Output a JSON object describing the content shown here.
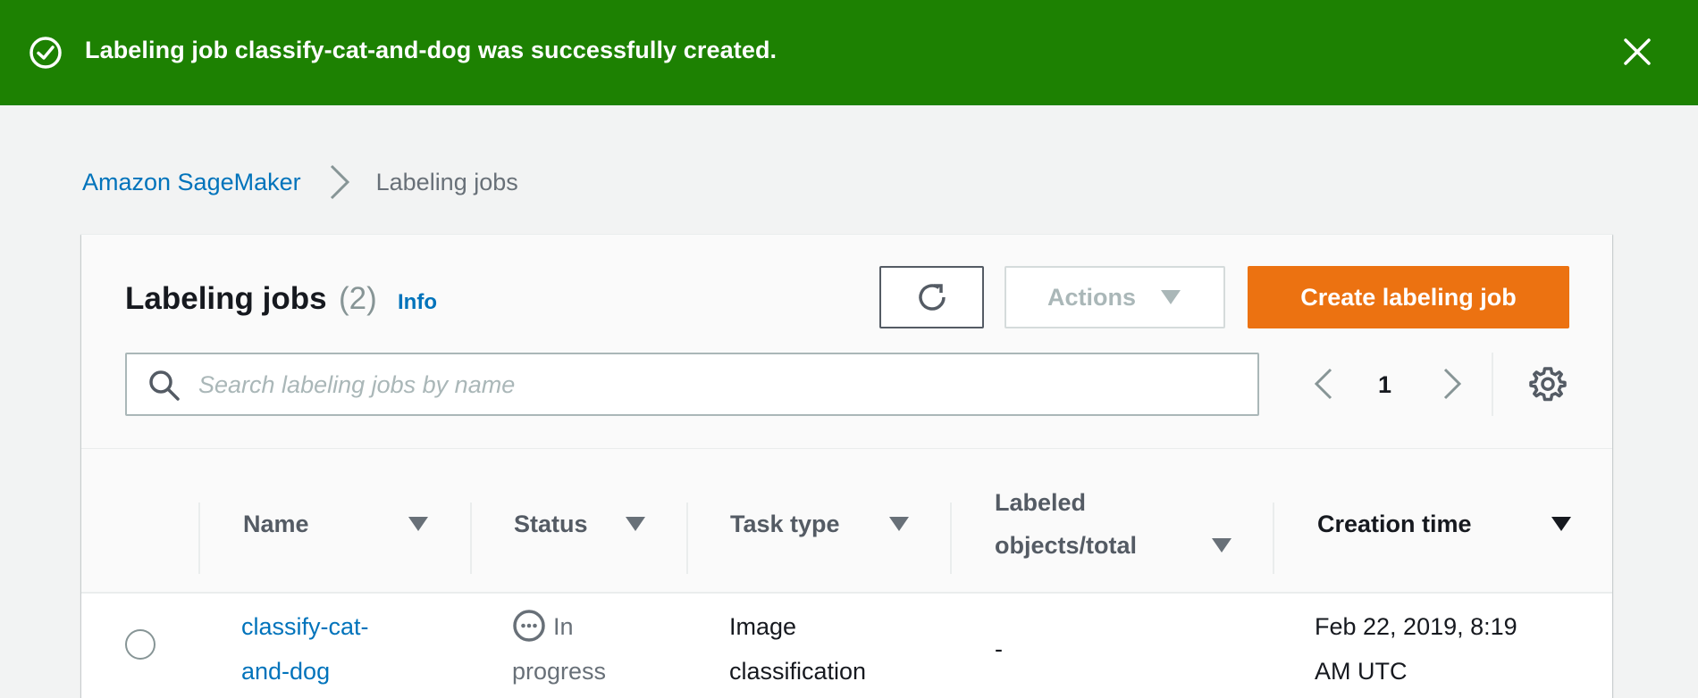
{
  "flash": {
    "message": "Labeling job classify-cat-and-dog was successfully created.",
    "type": "success",
    "color": "#1d8102"
  },
  "breadcrumb": {
    "root": "Amazon SageMaker",
    "current": "Labeling jobs"
  },
  "panel": {
    "title": "Labeling jobs",
    "count": "(2)",
    "info_label": "Info",
    "actions_label": "Actions",
    "create_label": "Create labeling job",
    "search_placeholder": "Search labeling jobs by name",
    "page_number": "1"
  },
  "table": {
    "columns": [
      {
        "label": "Name"
      },
      {
        "label": "Status"
      },
      {
        "label": "Task type"
      },
      {
        "label_line1": "Labeled",
        "label_line2": "objects/total"
      },
      {
        "label": "Creation time"
      }
    ],
    "rows": [
      {
        "name_line1": "classify-cat-",
        "name_line2": "and-dog",
        "status_line1": "In",
        "status_line2": "progress",
        "task_line1": "Image",
        "task_line2": "classification",
        "labeled": "-",
        "created_line1": "Feb 22, 2019, 8:19",
        "created_line2": "AM UTC"
      }
    ]
  },
  "colors": {
    "accent_link": "#0073bb",
    "primary_button": "#ec7211",
    "success": "#1d8102"
  }
}
